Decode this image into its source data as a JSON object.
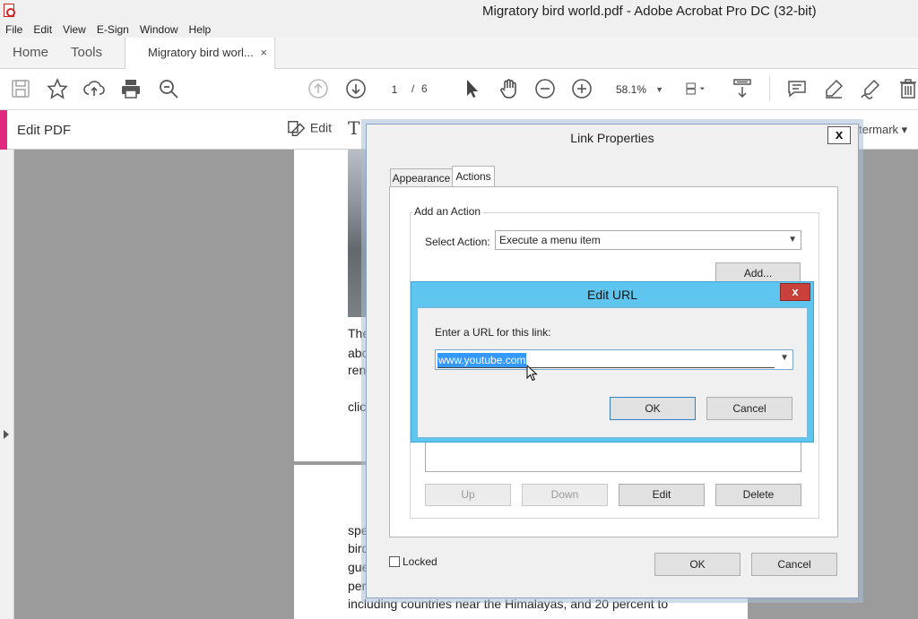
{
  "window": {
    "title": "Migratory bird world.pdf - Adobe Acrobat Pro DC (32-bit)"
  },
  "menu": [
    "File",
    "Edit",
    "View",
    "E-Sign",
    "Window",
    "Help"
  ],
  "tabs": {
    "home": "Home",
    "tools": "Tools",
    "document": "Migratory bird worl...",
    "close": "×"
  },
  "toolbar": {
    "page_current": "1",
    "page_sep": "/",
    "page_total": "6",
    "zoom": "58.1%",
    "icons": [
      "save-icon",
      "star-icon",
      "cloud-upload-icon",
      "print-icon",
      "search-icon",
      "page-up-icon",
      "page-down-icon",
      "select-arrow-icon",
      "hand-icon",
      "zoom-out-icon",
      "zoom-in-icon",
      "page-fit-icon",
      "scroll-mode-icon",
      "comment-icon",
      "highlight-icon",
      "sign-icon",
      "delete-icon"
    ]
  },
  "editbar": {
    "label": "Edit PDF",
    "edit": "Edit",
    "text_tool": "T",
    "watermark": "termark ▾"
  },
  "document": {
    "page1_lines": [
      "The",
      "abo",
      "ren",
      "clic"
    ],
    "page2_lines": [
      "spe",
      "bird",
      "gue",
      "per",
      "including countries near the Himalayas, and 20 percent to"
    ]
  },
  "link_properties": {
    "title": "Link Properties",
    "close": "x",
    "tab_appearance": "Appearance",
    "tab_actions": "Actions",
    "group_label": "Add an Action",
    "select_action_label": "Select Action:",
    "select_action_value": "Execute a menu item",
    "add_button": "Add...",
    "up_button": "Up",
    "down_button": "Down",
    "edit_button": "Edit",
    "delete_button": "Delete",
    "locked_label": "Locked",
    "ok_button": "OK",
    "cancel_button": "Cancel"
  },
  "edit_url": {
    "title": "Edit URL",
    "close": "x",
    "prompt": "Enter a URL for this link:",
    "url_value": "www.youtube.com",
    "ok_button": "OK",
    "cancel_button": "Cancel"
  }
}
